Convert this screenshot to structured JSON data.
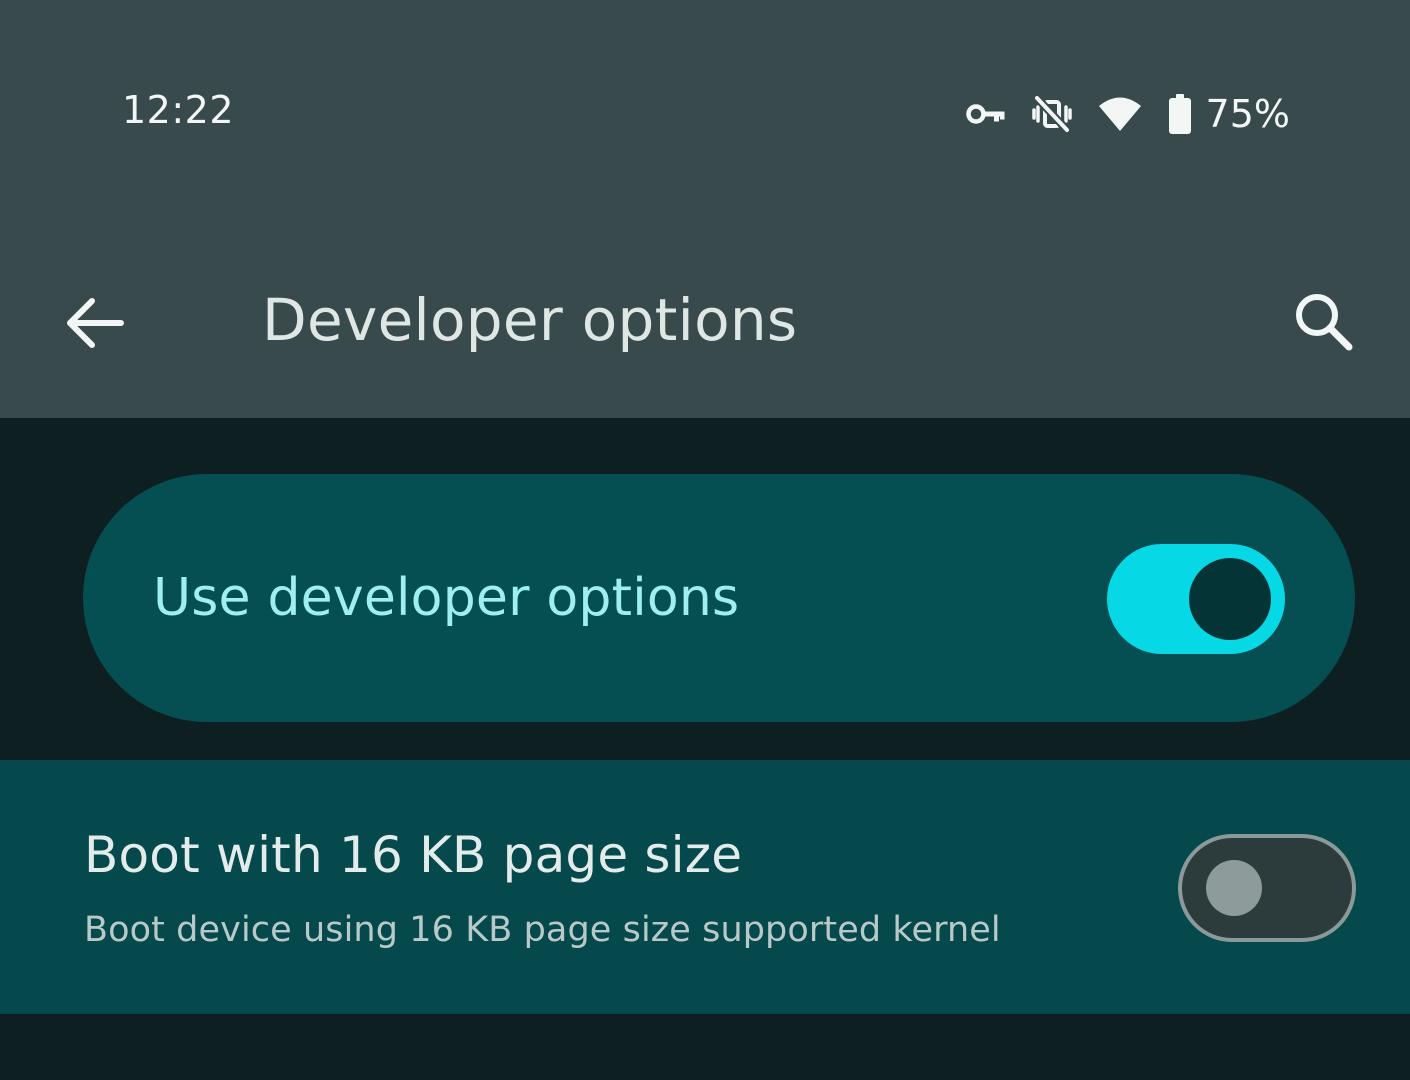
{
  "status_bar": {
    "time": "12:22",
    "battery_percent": "75%",
    "icons": [
      "vpn-key-icon",
      "vibrate-off-icon",
      "wifi-icon",
      "battery-icon"
    ]
  },
  "app_bar": {
    "title": "Developer options",
    "back_icon": "arrow-back-icon",
    "search_icon": "search-icon"
  },
  "main_switch": {
    "label": "Use developer options",
    "checked": true
  },
  "settings": [
    {
      "title": "Boot with 16 KB page size",
      "summary": "Boot device using 16 KB page size supported kernel",
      "checked": false
    }
  ],
  "colors": {
    "app_bar_bg": "#384a4b",
    "page_bg": "#0e1f21",
    "card_bg": "#054e52",
    "switch_on_track": "#06d8e6",
    "switch_on_thumb": "#043436",
    "main_label": "#9fefee"
  }
}
